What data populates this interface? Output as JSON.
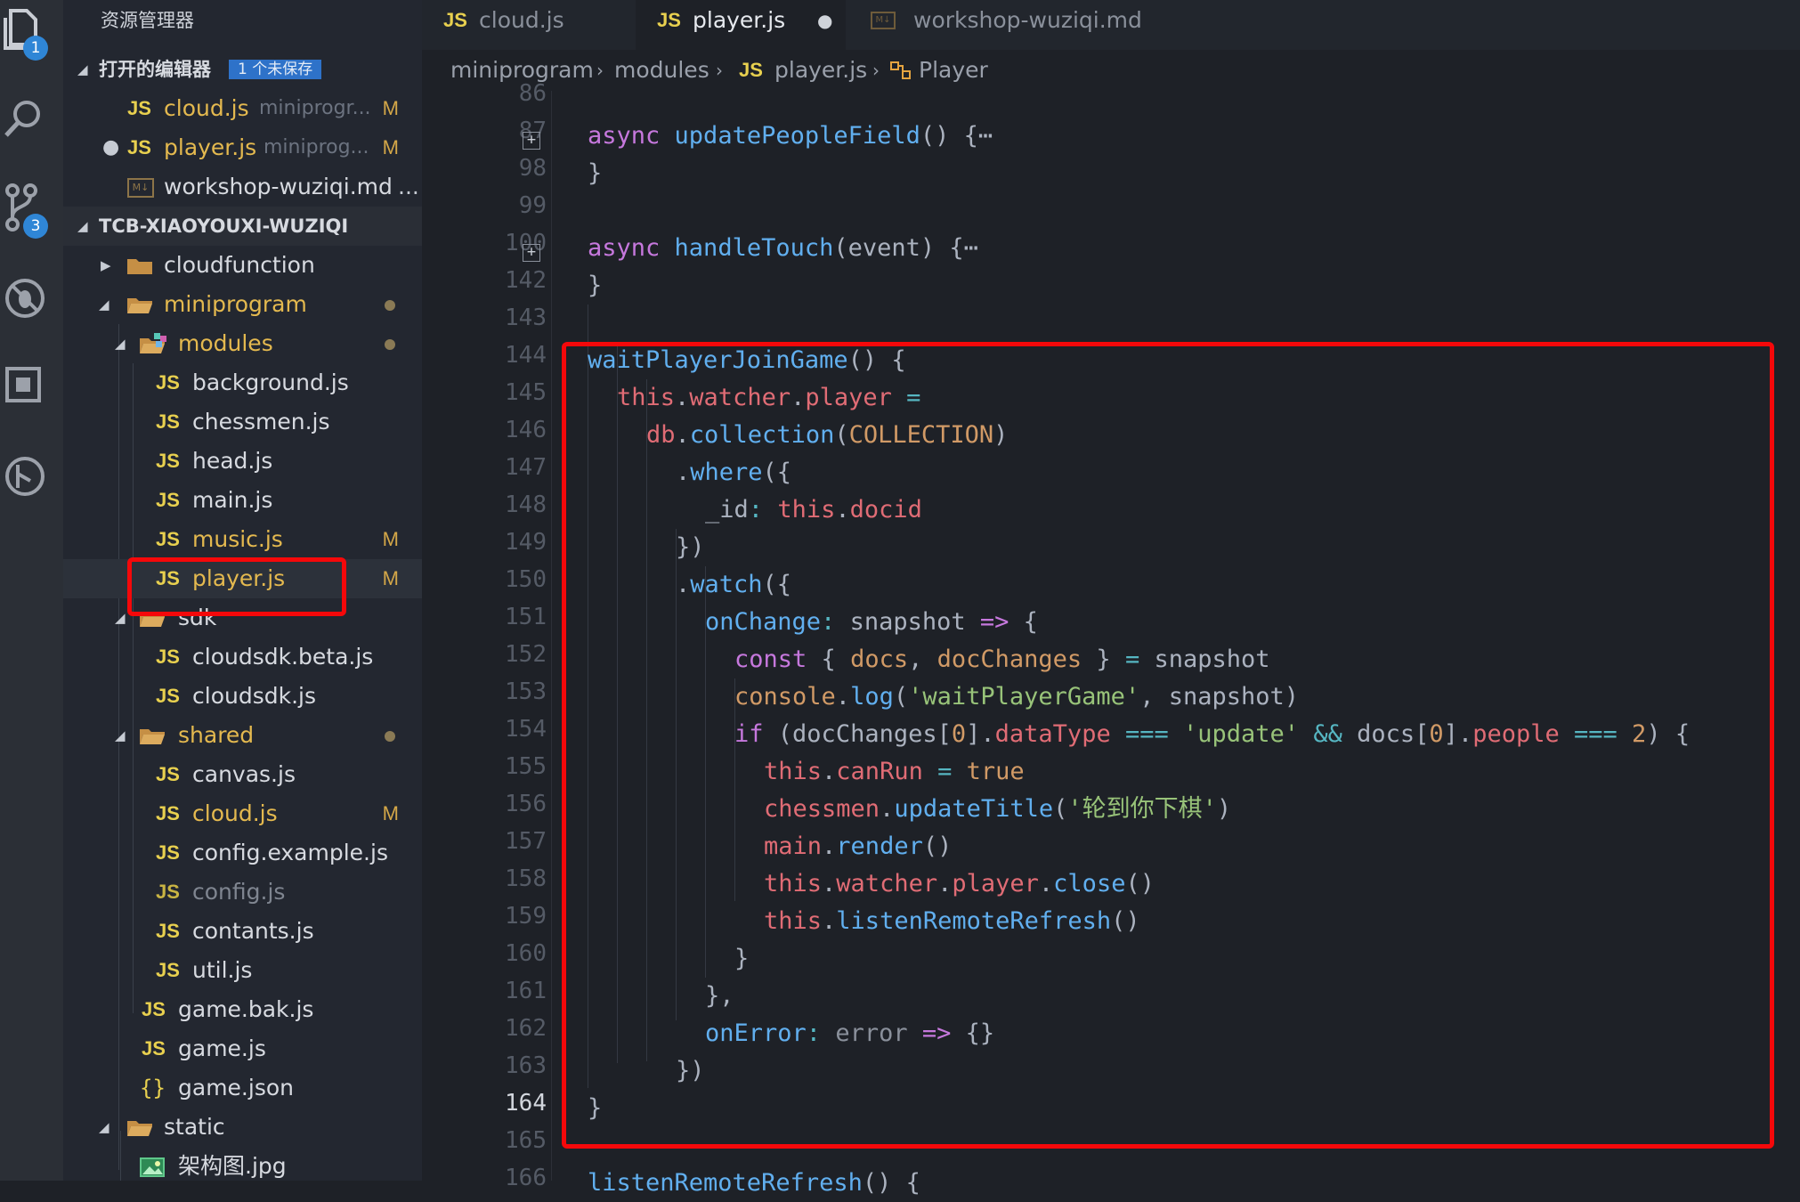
{
  "activity_bar": {
    "explorer_badge": "1",
    "scm_badge": "3",
    "icons": [
      "files-icon",
      "search-icon",
      "source-control-icon",
      "debug-icon",
      "extensions-icon",
      "remote-icon"
    ]
  },
  "sidebar": {
    "title": "资源管理器",
    "open_editors": {
      "label": "打开的编辑器",
      "unsaved_badge": "1 个未保存",
      "items": [
        {
          "icon": "JS",
          "name": "cloud.js",
          "path": "miniprogr...",
          "status": "M"
        },
        {
          "icon": "JS",
          "name": "player.js",
          "path": "miniprog...",
          "status": "M",
          "dirty": "●"
        },
        {
          "icon": "md",
          "name": "workshop-wuziqi.md",
          "path": "..."
        }
      ]
    },
    "workspace": {
      "label": "TCB-XIAOYOUXI-WUZIQI",
      "items": [
        {
          "type": "folder",
          "name": "cloudfunction"
        },
        {
          "type": "folder",
          "name": "miniprogram"
        },
        {
          "type": "folder",
          "name": "modules"
        },
        {
          "type": "js",
          "name": "background.js"
        },
        {
          "type": "js",
          "name": "chessmen.js"
        },
        {
          "type": "js",
          "name": "head.js"
        },
        {
          "type": "js",
          "name": "main.js"
        },
        {
          "type": "js",
          "name": "music.js",
          "status": "M"
        },
        {
          "type": "js",
          "name": "player.js",
          "status": "M"
        },
        {
          "type": "folder",
          "name": "sdk"
        },
        {
          "type": "js",
          "name": "cloudsdk.beta.js"
        },
        {
          "type": "js",
          "name": "cloudsdk.js"
        },
        {
          "type": "folder",
          "name": "shared"
        },
        {
          "type": "js",
          "name": "canvas.js"
        },
        {
          "type": "js",
          "name": "cloud.js",
          "status": "M"
        },
        {
          "type": "js",
          "name": "config.example.js"
        },
        {
          "type": "js",
          "name": "config.js"
        },
        {
          "type": "js",
          "name": "contants.js"
        },
        {
          "type": "js",
          "name": "util.js"
        },
        {
          "type": "js",
          "name": "game.bak.js"
        },
        {
          "type": "js",
          "name": "game.js"
        },
        {
          "type": "json",
          "name": "game.json"
        },
        {
          "type": "folder",
          "name": "static"
        },
        {
          "type": "image",
          "name": "架构图.jpg"
        }
      ]
    }
  },
  "tabs": [
    {
      "icon": "JS",
      "label": "cloud.js"
    },
    {
      "icon": "JS",
      "label": "player.js",
      "dirty": "●"
    },
    {
      "icon": "md",
      "label": "workshop-wuziqi.md"
    }
  ],
  "breadcrumbs": {
    "items": [
      "miniprogram",
      "modules",
      "player.js",
      "Player"
    ],
    "separator": "›"
  },
  "gutter": {
    "line_numbers": [
      "86",
      "87",
      "98",
      "99",
      "100",
      "142",
      "143",
      "144",
      "145",
      "146",
      "147",
      "148",
      "149",
      "150",
      "151",
      "152",
      "153",
      "154",
      "155",
      "156",
      "157",
      "158",
      "159",
      "160",
      "161",
      "162",
      "163",
      "164",
      "165",
      "166"
    ],
    "current_line": "164",
    "fold_marker": "+"
  },
  "code": {
    "line_87": {
      "kw": "async",
      "fn": "updatePeopleField",
      "rest": "() {",
      "ellipsis": "⋯"
    },
    "line_98": "}",
    "line_100": {
      "kw": "async",
      "fn": "handleTouch",
      "rest": "(event) {",
      "ellipsis": "⋯"
    },
    "line_142": "}",
    "line_144": {
      "fn": "waitPlayerJoinGame",
      "rest": "() {"
    },
    "line_145": {
      "a": "this",
      "b": "watcher",
      "c": "player",
      "op": "="
    },
    "line_146": {
      "a": "db",
      "b": "collection",
      "c": "COLLECTION"
    },
    "line_147": {
      "fn": "where",
      "rest": "({"
    },
    "line_148": {
      "key": "_id",
      "a": "this",
      "b": "docid"
    },
    "line_149": "})",
    "line_150": {
      "fn": "watch",
      "rest": "({"
    },
    "line_151": {
      "key": "onChange",
      "param": "snapshot",
      "arrow": "=>"
    },
    "line_152": {
      "kw": "const",
      "a": "docs",
      "b": "docChanges",
      "op": "=",
      "rest": "snapshot"
    },
    "line_153": {
      "a": "console",
      "fn": "log",
      "str": "'waitPlayerGame'",
      "rest": "snapshot"
    },
    "line_154": {
      "kw": "if",
      "a": "docChanges",
      "idx": "0",
      "b": "dataType",
      "op": "===",
      "str": "'update'",
      "and": "&&",
      "c": "docs",
      "d": "people",
      "num": "2"
    },
    "line_155": {
      "a": "this",
      "b": "canRun",
      "op": "=",
      "val": "true"
    },
    "line_156": {
      "a": "chessmen",
      "fn": "updateTitle",
      "str": "'轮到你下棋'"
    },
    "line_157": {
      "a": "main",
      "fn": "render"
    },
    "line_158": {
      "a": "this",
      "b": "watcher",
      "c": "player",
      "fn": "close"
    },
    "line_159": {
      "a": "this",
      "fn": "listenRemoteRefresh"
    },
    "line_160": "}",
    "line_161": "},",
    "line_162": {
      "key": "onError",
      "param": "error",
      "arrow": "=>",
      "rest": "{}"
    },
    "line_163": "})",
    "line_164": "}",
    "line_166": {
      "fn": "listenRemoteRefresh",
      "rest": "() {"
    }
  },
  "colors": {
    "highlight_box": "#f5080a",
    "keyword": "#c678dd",
    "function": "#61afef",
    "property": "#e06c75",
    "string": "#98c379",
    "number": "#d19a66",
    "js_icon": "#e8d04f"
  }
}
